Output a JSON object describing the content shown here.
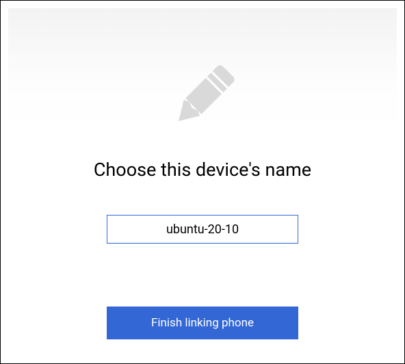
{
  "heading": "Choose this device's name",
  "device_name_input": {
    "value": "ubuntu-20-10",
    "placeholder": ""
  },
  "finish_button_label": "Finish linking phone",
  "icon": "pencil-icon",
  "colors": {
    "accent": "#3367d6",
    "icon_fill": "#d9d9d9"
  }
}
